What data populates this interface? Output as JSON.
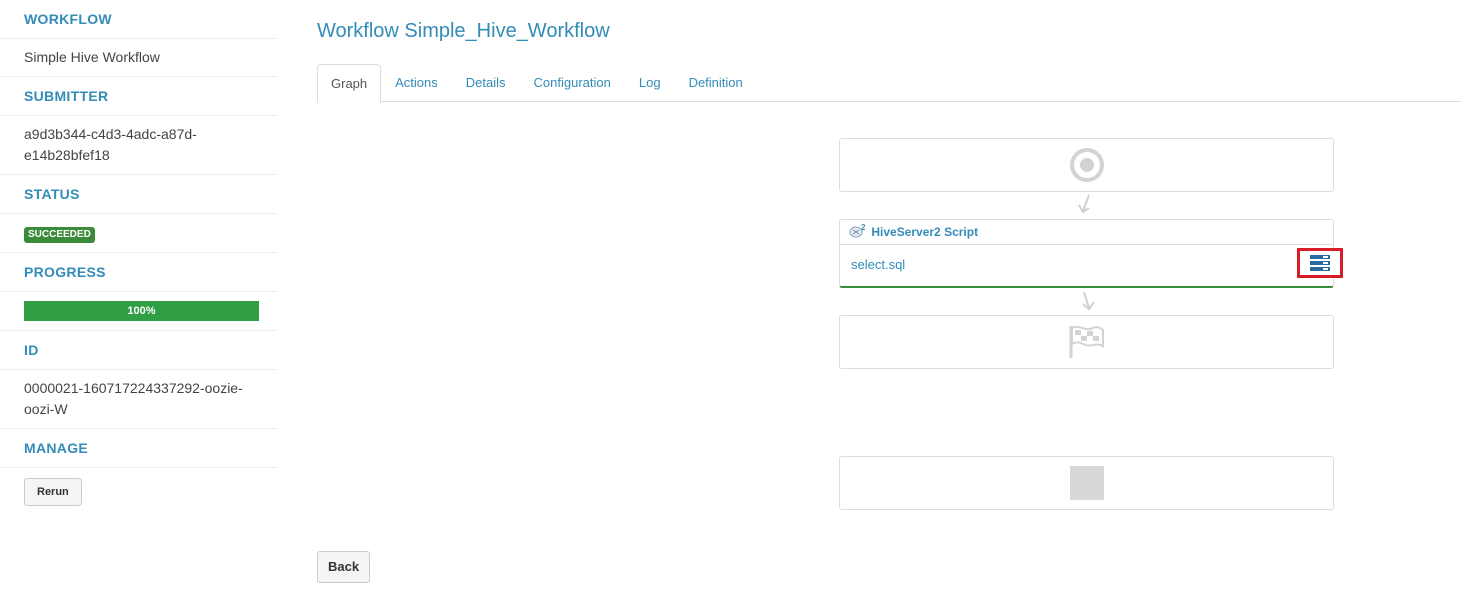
{
  "sidebar": {
    "workflow_label": "WORKFLOW",
    "workflow_value": "Simple Hive Workflow",
    "submitter_label": "SUBMITTER",
    "submitter_value_line1": "a9d3b344-c4d3-4adc-a87d-",
    "submitter_value_line2": "e14b28bfef18",
    "status_label": "STATUS",
    "status_value": "SUCCEEDED",
    "progress_label": "PROGRESS",
    "progress_text": "100%",
    "progress_value": 100,
    "id_label": "ID",
    "id_value_line1": "0000021-160717224337292-oozie-",
    "id_value_line2": "oozi-W",
    "manage_label": "MANAGE",
    "rerun_label": "Rerun"
  },
  "page": {
    "title": "Workflow Simple_Hive_Workflow",
    "tabs": [
      {
        "label": "Graph",
        "active": true
      },
      {
        "label": "Actions",
        "active": false
      },
      {
        "label": "Details",
        "active": false
      },
      {
        "label": "Configuration",
        "active": false
      },
      {
        "label": "Log",
        "active": false
      },
      {
        "label": "Definition",
        "active": false
      }
    ],
    "back_label": "Back"
  },
  "graph": {
    "action_title": "HiveServer2 Script",
    "action_file": "select.sql",
    "icons": [
      "start-target-icon",
      "hive-icon",
      "configuration-icon",
      "end-flag-icon",
      "kill-square-icon",
      "arrow-down-icon"
    ]
  },
  "colors": {
    "accent": "#338bb8",
    "success": "#3a8b3a",
    "progress": "#2f9e45",
    "highlight": "#d61d29"
  }
}
